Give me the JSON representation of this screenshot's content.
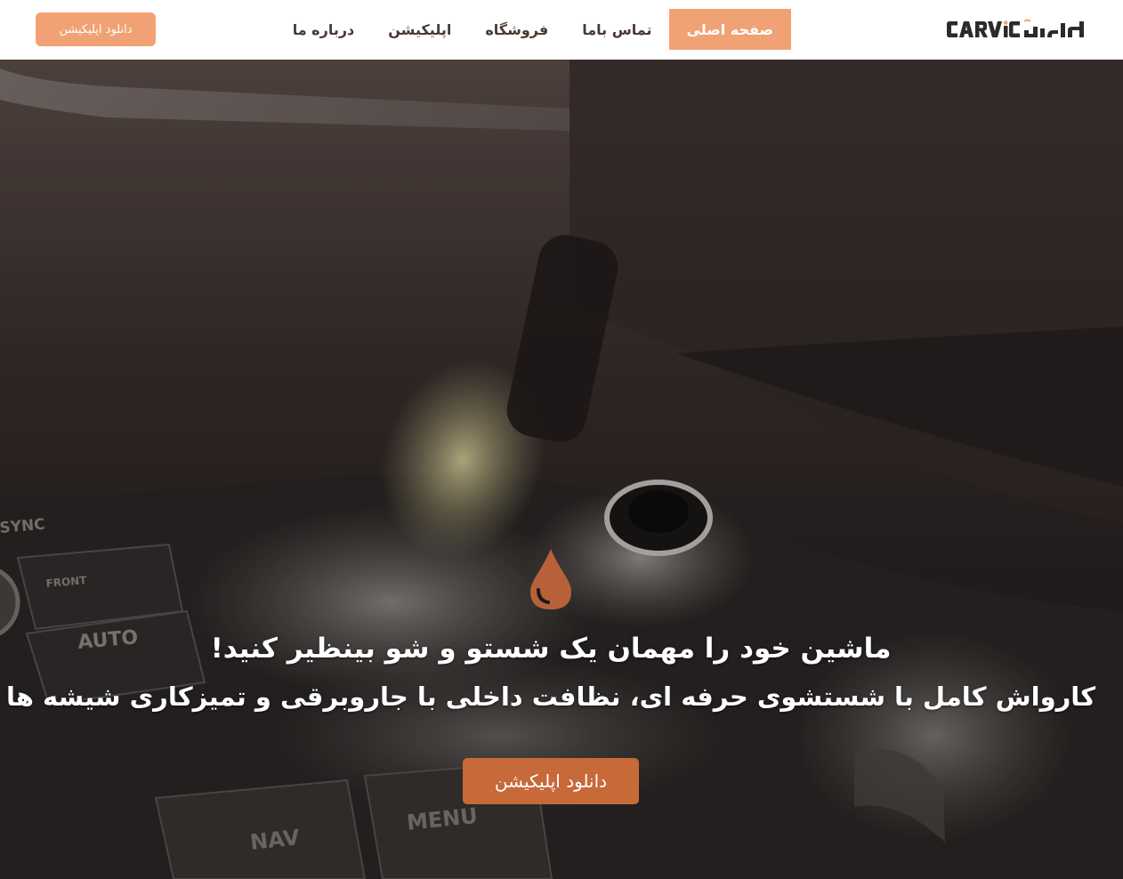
{
  "header": {
    "logo_text": "CARVIC کارویک",
    "download_button_label": "دانلود اپلیکیشن",
    "nav": [
      {
        "label": "صفحه اصلی",
        "active": true
      },
      {
        "label": "تماس باما",
        "active": false
      },
      {
        "label": "فروشگاه",
        "active": false
      },
      {
        "label": "اپلیکیشن",
        "active": false
      },
      {
        "label": "درباره ما",
        "active": false
      }
    ]
  },
  "hero": {
    "icon": "water-drop-icon",
    "title": "ماشین خود را مهمان یک شستو و شو بینظیر کنید!",
    "subtitle": "کارواش کامل با شستشوی حرفه ای، نظافت داخلی با جاروبرقی و تمیزکاری شیشه ها",
    "cta_label": "دانلود اپلیکیشن",
    "console_labels": [
      "SYNC",
      "FRONT",
      "AUTO",
      "NAV",
      "MENU"
    ]
  },
  "colors": {
    "accent": "#f0a274",
    "cta": "#c8693a",
    "drop": "#b8603a",
    "nav_text": "#4a3a32",
    "header_bg": "#ffffff"
  }
}
